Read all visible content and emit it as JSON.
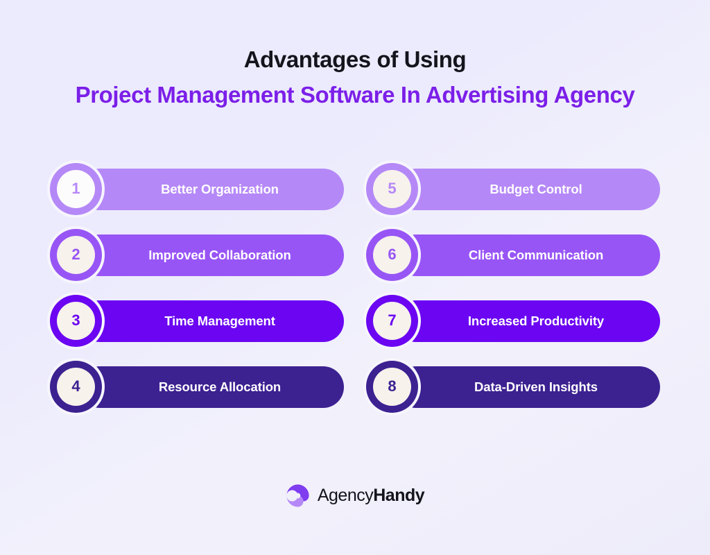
{
  "heading": {
    "line1": "Advantages of Using",
    "line2": "Project Management Software In Advertising Agency",
    "line1_color": "#14141c",
    "line2_color": "#7b1fe8"
  },
  "items": [
    {
      "number": "1",
      "label": "Better Organization",
      "pill_color": "#b588f7",
      "ring_color": "#b588f7",
      "inner_color": "#fdfcfc",
      "number_color": "#b588f7"
    },
    {
      "number": "2",
      "label": "Improved Collaboration",
      "pill_color": "#9855f5",
      "ring_color": "#9855f5",
      "inner_color": "#f7f2ec",
      "number_color": "#9855f5"
    },
    {
      "number": "3",
      "label": "Time Management",
      "pill_color": "#6b05f2",
      "ring_color": "#6b05f2",
      "inner_color": "#f7f2ec",
      "number_color": "#6b05f2"
    },
    {
      "number": "4",
      "label": "Resource Allocation",
      "pill_color": "#3c2191",
      "ring_color": "#3c2191",
      "inner_color": "#f7f2ec",
      "number_color": "#3c2191"
    },
    {
      "number": "5",
      "label": "Budget Control",
      "pill_color": "#b588f7",
      "ring_color": "#b588f7",
      "inner_color": "#f7f2ec",
      "number_color": "#b588f7"
    },
    {
      "number": "6",
      "label": "Client Communication",
      "pill_color": "#9855f5",
      "ring_color": "#9855f5",
      "inner_color": "#f7f2ec",
      "number_color": "#9855f5"
    },
    {
      "number": "7",
      "label": "Increased Productivity",
      "pill_color": "#6b05f2",
      "ring_color": "#6b05f2",
      "inner_color": "#f7f2ec",
      "number_color": "#6b05f2"
    },
    {
      "number": "8",
      "label": "Data-Driven Insights",
      "pill_color": "#3c2191",
      "ring_color": "#3c2191",
      "inner_color": "#f7f2ec",
      "number_color": "#3c2191"
    }
  ],
  "footer": {
    "logo_icon": "agencyhandy-swirl-icon",
    "brand_light": "Agency",
    "brand_bold": "Handy",
    "logo_color_light": "#b588f7",
    "logo_color_dark": "#6b05f2"
  },
  "background": {
    "color_start": "#ecebfd",
    "color_end": "#eeecfa"
  }
}
